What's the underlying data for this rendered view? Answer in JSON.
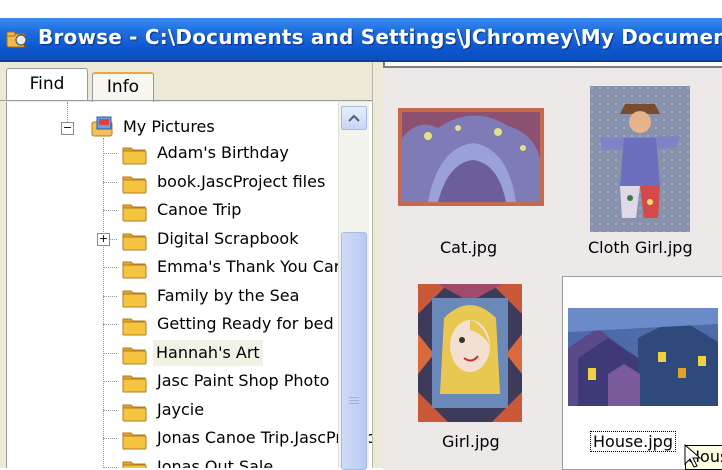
{
  "window": {
    "title": "Browse - C:\\Documents and Settings\\JChromey\\My Documents",
    "icon": "folder-browse-icon"
  },
  "tabs": [
    {
      "label": "Find"
    },
    {
      "label": "Info"
    }
  ],
  "tree": {
    "root": {
      "label": "My Pictures",
      "expander": "⊟",
      "icon": "my-pictures-folder-icon"
    },
    "items": [
      {
        "label": "Adam's Birthday",
        "expander": ""
      },
      {
        "label": "book.JascProject files",
        "expander": ""
      },
      {
        "label": "Canoe Trip",
        "expander": ""
      },
      {
        "label": "Digital Scrapbook",
        "expander": "+"
      },
      {
        "label": "Emma's Thank You Cards",
        "expander": ""
      },
      {
        "label": "Family by the Sea",
        "expander": ""
      },
      {
        "label": "Getting Ready for bed",
        "expander": ""
      },
      {
        "label": "Hannah's Art",
        "expander": "",
        "selected": true
      },
      {
        "label": "Jasc Paint Shop Photo",
        "expander": ""
      },
      {
        "label": "Jaycie",
        "expander": ""
      },
      {
        "label": "Jonas Canoe Trip.JascProject",
        "expander": ""
      },
      {
        "label": "Jonas Out Sale...",
        "expander": ""
      }
    ]
  },
  "thumbnails": [
    {
      "label": "Cat.jpg"
    },
    {
      "label": "Cloth Girl.jpg"
    },
    {
      "label": "Girl.jpg"
    },
    {
      "label": "House.jpg"
    }
  ],
  "tooltip": {
    "text": "House.jpg"
  },
  "colors": {
    "title_bar": "#0f58d0",
    "pane_bg": "#ece9d8",
    "thumb_area_bg": "#ede9e8",
    "folder": "#f5c542",
    "tooltip_bg": "#ffffe1"
  }
}
